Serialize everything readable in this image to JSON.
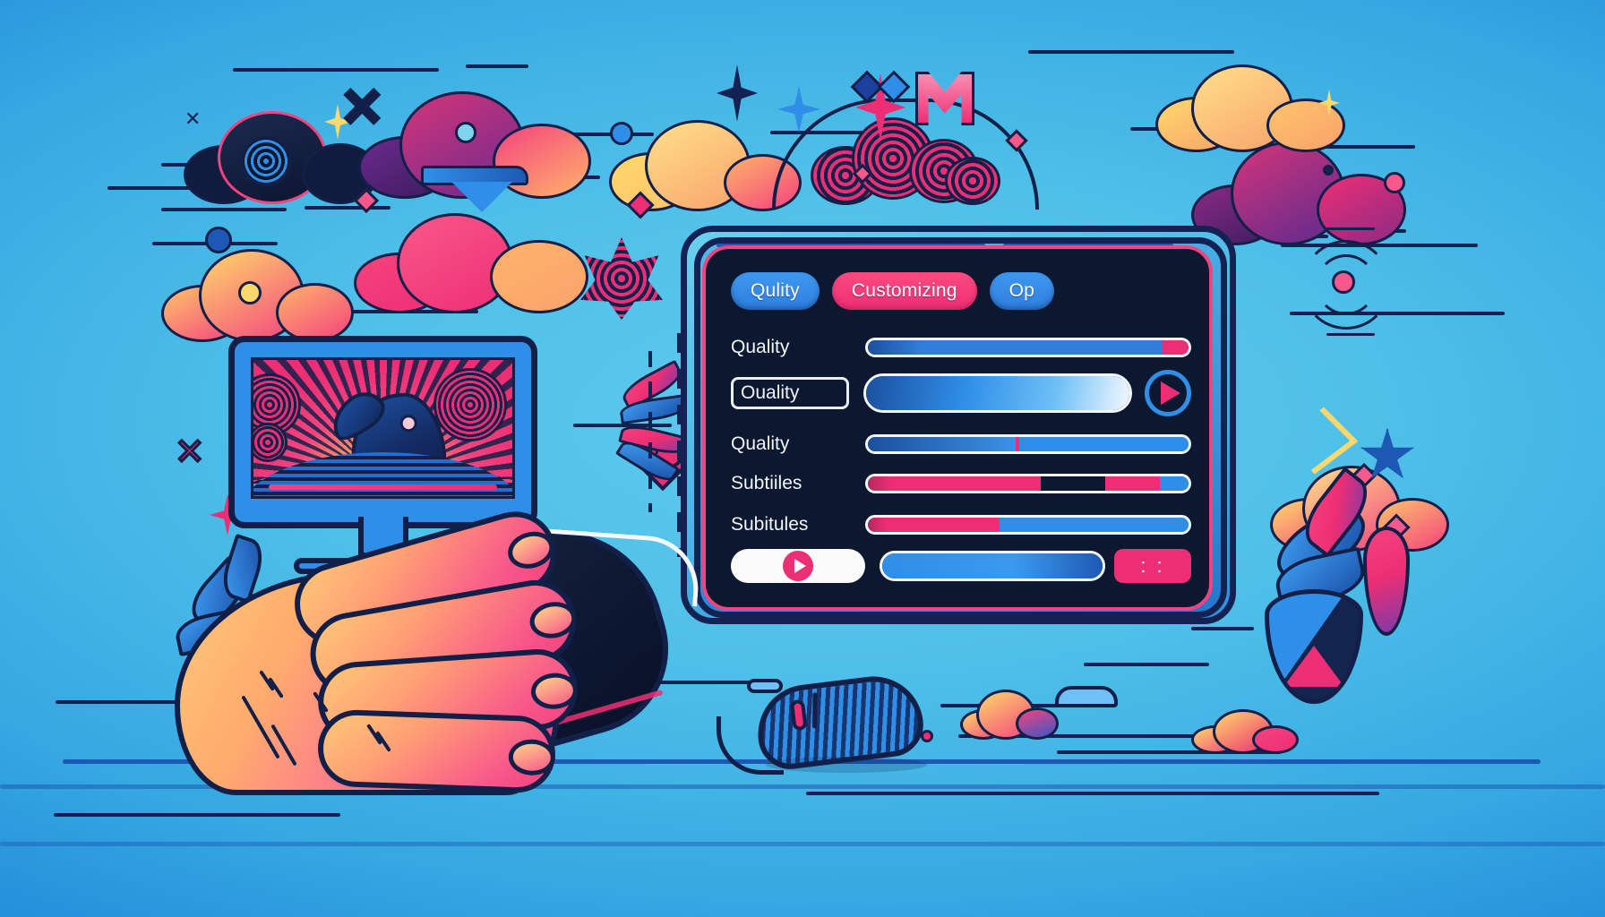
{
  "scene": {
    "title": "Video player settings customization illustration",
    "background_colors": {
      "top_left": "#2f92dd",
      "center": "#5ec9ec",
      "bottom_right": "#1571cf"
    },
    "accent_colors": {
      "pink": "#ee2e74",
      "blue": "#2f8fe8",
      "dark": "#0c1730",
      "outline": "#122049",
      "white": "#f3f7ff"
    }
  },
  "panel": {
    "tabs": [
      {
        "label": "Qulity",
        "style": "blue"
      },
      {
        "label": "Customizing",
        "style": "pink"
      },
      {
        "label": "Op",
        "style": "blue"
      }
    ],
    "rows": [
      {
        "label": "Quality",
        "label_boxed": false,
        "control": "slider",
        "fill_percent": 92,
        "fill_color": "#2f7fd8",
        "tail_color": "#ee2e74",
        "trailing": "none"
      },
      {
        "label": "Ouality",
        "label_boxed": true,
        "control": "slider-tall",
        "fill_percent": 100,
        "fill_color": "#2f8fe8",
        "tail_color": "#ffffff",
        "trailing": "play-circle"
      },
      {
        "label": "Quality",
        "label_boxed": false,
        "control": "slider",
        "fill_percent": 46,
        "fill_color": "#2f7fd8",
        "tail_color": "#2f8fe8",
        "trailing": "none"
      },
      {
        "label": "Subtiiles",
        "label_boxed": false,
        "control": "slider-segmented",
        "fill_percent": 54,
        "fill_color": "#ee2e74",
        "gap_start_percent": 54,
        "gap_end_percent": 74,
        "second_fill_end_percent": 91,
        "tail_color": "#2f8fe8",
        "trailing": "none"
      },
      {
        "label": "Subitules",
        "label_boxed": false,
        "control": "slider",
        "fill_percent": 41,
        "fill_color": "#ee2e74",
        "tail_color": "#2f8fe8",
        "trailing": "none"
      }
    ],
    "footer": {
      "play_pill_icon": "play-icon",
      "progress_percent": 78,
      "progress_color": "#2f8fe8",
      "end_cap_label": ": :",
      "end_cap_color": "#ee2e74"
    }
  },
  "monitor": {
    "screen_content": "dolphin-silhouette-sunburst-waves",
    "bezel_color": "#2f8fe8",
    "progress_bar_color": "#ee2e74"
  },
  "devices": {
    "primary_mouse": {
      "name": "hand-on-mouse",
      "body_color": "#0d1833",
      "wheel_color": "#ee2e74"
    },
    "secondary_mouse": {
      "name": "striped-mouse",
      "body_color": "#2f8fe8"
    }
  },
  "decorations": {
    "clouds": [
      {
        "name": "cloud-dark",
        "colors": [
          "#0c1730",
          "#ee2e74"
        ]
      },
      {
        "name": "cloud-magenta",
        "colors": [
          "#ee2e74",
          "#6b2a8e"
        ]
      },
      {
        "name": "cloud-sunset",
        "colors": [
          "#ffd86b",
          "#f4437e"
        ]
      },
      {
        "name": "cloud-pink",
        "colors": [
          "#ee2e74",
          "#ffb36b"
        ]
      },
      {
        "name": "cloud-yellow",
        "colors": [
          "#ffd86b",
          "#f4437e"
        ]
      },
      {
        "name": "cloud-purple-right",
        "colors": [
          "#ee2e74",
          "#5c2a8e"
        ]
      }
    ],
    "glyphs": [
      {
        "name": "sparkle-icon",
        "color": "#ee2e74"
      },
      {
        "name": "four-point-star-icon",
        "color": "#132252"
      },
      {
        "name": "burst-star-icon",
        "color": "#2f8fe8"
      },
      {
        "name": "m-logo-icon",
        "color": "#ee2e74"
      },
      {
        "name": "x-mark-icon",
        "color": "#2f8fe8"
      },
      {
        "name": "diamond-icon",
        "color": "#ee2e74"
      },
      {
        "name": "heart-icon",
        "color": "#ee2e74"
      },
      {
        "name": "shield-icon",
        "color": "#2f8fe8"
      },
      {
        "name": "leaf-icon",
        "color": "#2f8fe8"
      },
      {
        "name": "radar-waves-icon",
        "color": "#132252"
      },
      {
        "name": "spiral-cluster-icon",
        "color": "#ee2e74"
      },
      {
        "name": "six-point-star-icon",
        "color": "#1d59b4"
      }
    ]
  }
}
